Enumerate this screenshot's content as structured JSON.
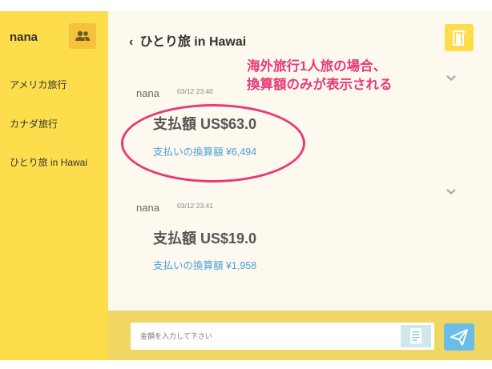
{
  "sidebar": {
    "user_name": "nana",
    "items": [
      {
        "label": "アメリカ旅行"
      },
      {
        "label": "カナダ旅行"
      },
      {
        "label": "ひとり旅 in Hawai"
      }
    ]
  },
  "header": {
    "back_icon": "chevron-left-icon",
    "title": "ひとり旅 in Hawai",
    "exit_icon": "door-exit-icon"
  },
  "annotation": {
    "line1": "海外旅行1人旅の場合、",
    "line2": "換算額のみが表示される"
  },
  "messages": [
    {
      "user": "nana",
      "time": "03/12 23:40",
      "amount": "支払額 US$63.0",
      "converted": "支払いの換算額 ¥6,494"
    },
    {
      "user": "nana",
      "time": "03/12 23:41",
      "amount": "支払額 US$19.0",
      "converted": "支払いの換算額 ¥1,958"
    }
  ],
  "input": {
    "placeholder": "金額を入力して下さい",
    "value": ""
  },
  "colors": {
    "sidebar_bg": "#fddd4b",
    "main_bg": "#fdf9ee",
    "bottom_bar_bg": "#f0d764",
    "annotation": "#e8397a",
    "link_blue": "#4a9fd8",
    "send_button": "#69bde8"
  }
}
